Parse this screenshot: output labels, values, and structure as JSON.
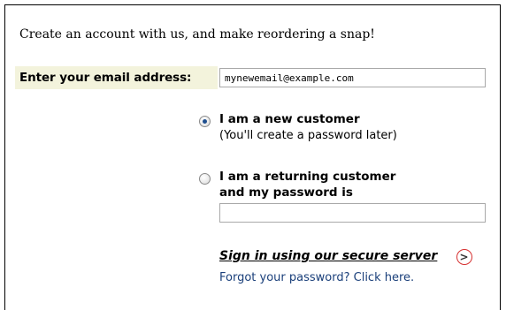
{
  "intro_text": "Create an account with us, and make reordering a snap!",
  "email": {
    "label": "Enter your email address:",
    "value": "mynewemail@example.com"
  },
  "options": {
    "new_customer": {
      "title": "I am a new customer",
      "subtitle": "(You'll create a password later)",
      "selected": true
    },
    "returning_customer": {
      "title_line1": "I am a returning customer",
      "title_line2": "and my password is",
      "selected": false
    }
  },
  "password": {
    "value": ""
  },
  "signin": {
    "label": "Sign in using our secure server",
    "icon": "circled-arrow-right-icon",
    "icon_glyph": ">",
    "icon_color": "#d63030"
  },
  "forgot_password": {
    "label": "Forgot your password? Click here."
  },
  "colors": {
    "label_background": "#f3f3dc",
    "link_blue": "#1a3f7a"
  }
}
